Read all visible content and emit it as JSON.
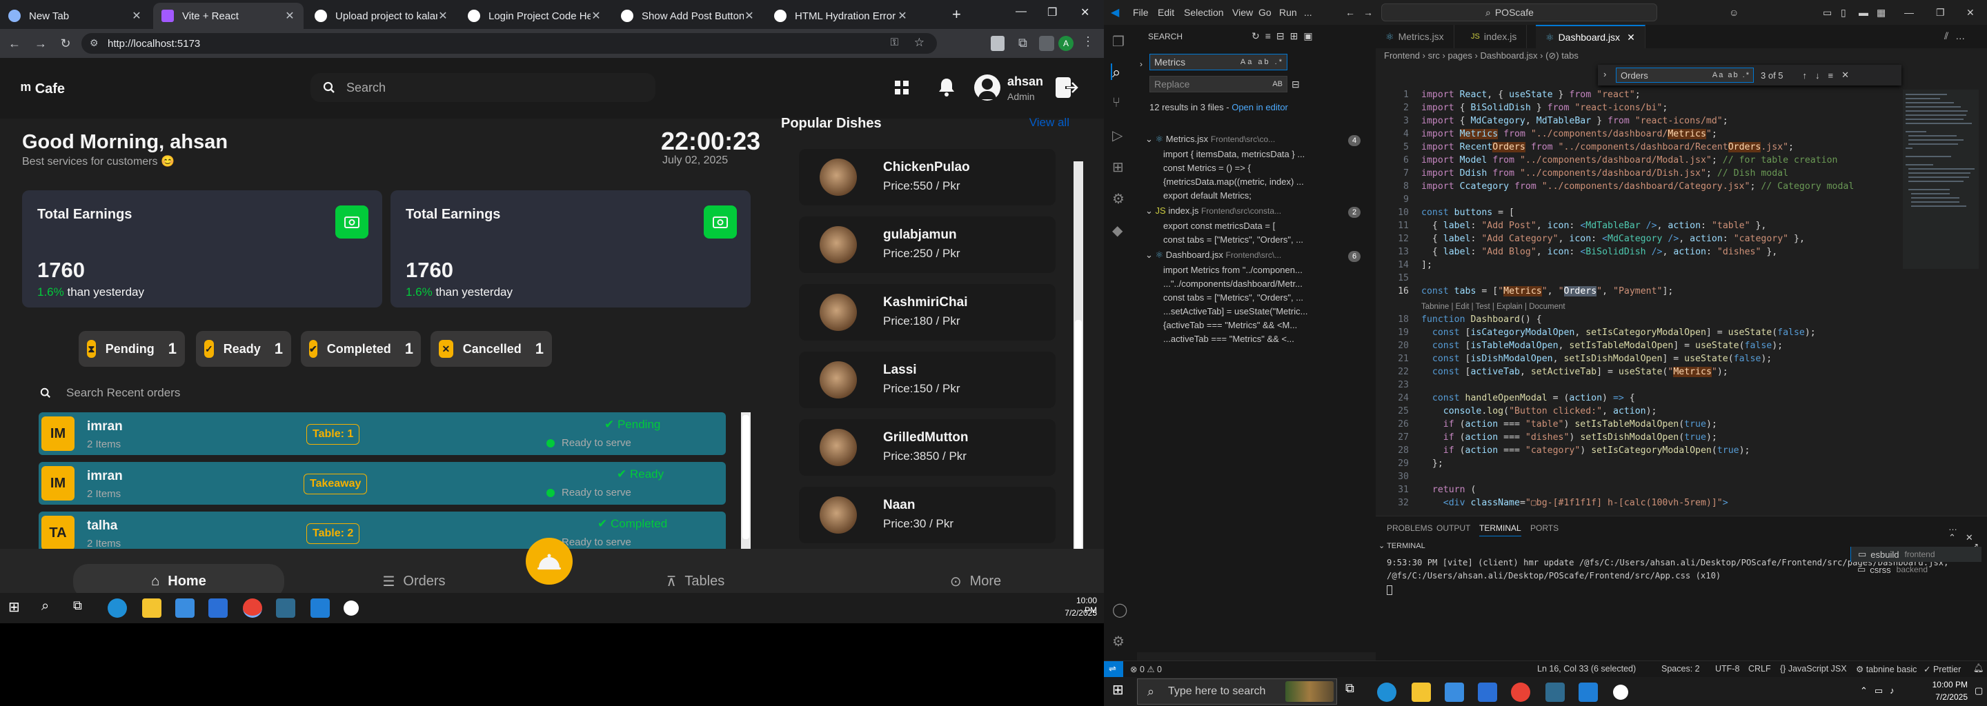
{
  "chrome": {
    "tabs": [
      {
        "title": "New Tab",
        "color": "#8ab4f8"
      },
      {
        "title": "Vite + React",
        "color": "#a259ff"
      },
      {
        "title": "Upload project to kalams.org",
        "color": "#ffffff"
      },
      {
        "title": "Login Project Code Help",
        "color": "#ffffff"
      },
      {
        "title": "Show Add Post Button",
        "color": "#ffffff"
      },
      {
        "title": "HTML Hydration Error Fix",
        "color": "#ffffff"
      }
    ],
    "url": "http://localhost:5173",
    "window_controls": {
      "min": "—",
      "max": "❐",
      "close": "✕"
    }
  },
  "app": {
    "logo": "Cafe",
    "search_placeholder": "Search",
    "user": {
      "name": "ahsan",
      "role": "Admin"
    },
    "greeting": "Good Morning, ahsan",
    "greeting_sub": "Best services for customers 😊",
    "time": "22:00:23",
    "date": "July 02, 2025",
    "earnings": [
      {
        "title": "Total Earnings",
        "value": "1760",
        "delta": "1.6%",
        "delta_text": "than yesterday"
      },
      {
        "title": "Total Earnings",
        "value": "1760",
        "delta": "1.6%",
        "delta_text": "than yesterday"
      }
    ],
    "stats": [
      {
        "label": "Pending",
        "count": "1"
      },
      {
        "label": "Ready",
        "count": "1"
      },
      {
        "label": "Completed",
        "count": "1"
      },
      {
        "label": "Cancelled",
        "count": "1"
      }
    ],
    "orders_search_placeholder": "Search Recent orders",
    "orders": [
      {
        "initials": "IM",
        "name": "imran",
        "items": "2 Items",
        "table": "Table: 1",
        "status": "Pending",
        "ready": "Ready to serve"
      },
      {
        "initials": "IM",
        "name": "imran",
        "items": "2 Items",
        "table": "Takeaway",
        "status": "Ready",
        "ready": "Ready to serve"
      },
      {
        "initials": "TA",
        "name": "talha",
        "items": "2 Items",
        "table": "Table: 2",
        "status": "Completed",
        "ready": "Ready to serve"
      }
    ],
    "dishes_title": "Popular Dishes",
    "view_all": "View all",
    "dishes": [
      {
        "name": "ChickenPulao",
        "price": "Price:550 / Pkr"
      },
      {
        "name": "gulabjamun",
        "price": "Price:250 / Pkr"
      },
      {
        "name": "KashmiriChai",
        "price": "Price:180 / Pkr"
      },
      {
        "name": "Lassi",
        "price": "Price:150 / Pkr"
      },
      {
        "name": "GrilledMutton",
        "price": "Price:3850 / Pkr"
      },
      {
        "name": "Naan",
        "price": "Price:30 / Pkr"
      }
    ],
    "nav": {
      "home": "Home",
      "orders": "Orders",
      "tables": "Tables",
      "more": "More"
    }
  },
  "taskbar_left": {
    "time": "10:00 PM",
    "date": "7/2/2025"
  },
  "vscode": {
    "menu": [
      "File",
      "Edit",
      "Selection",
      "View",
      "Go",
      "Run",
      "..."
    ],
    "command_center": "POScafe",
    "sidebar_title": "SEARCH",
    "search_value": "Metrics",
    "replace_placeholder": "Replace",
    "results_summary": "12 results in 3 files - ",
    "open_in_editor": "Open in editor",
    "files": [
      {
        "name": "Metrics.jsx",
        "path": "Frontend\\src\\co...",
        "count": "4",
        "matches": [
          "import { itemsData, metricsData } ...",
          "const Metrics = () => {",
          "{metricsData.map((metric, index) ...",
          "export default Metrics;"
        ]
      },
      {
        "name": "index.js",
        "path": "Frontend\\src\\consta...",
        "count": "2",
        "matches": [
          "export const metricsData = [",
          "const tabs = [\"Metrics\", \"Orders\", ..."
        ]
      },
      {
        "name": "Dashboard.jsx",
        "path": "Frontend\\src\\...",
        "count": "6",
        "matches": [
          "import Metrics from \"../componen...",
          "...\"../components/dashboard/Metr...",
          "const tabs = [\"Metrics\", \"Orders\", ...",
          "...setActiveTab] = useState(\"Metric...",
          "{activeTab === \"Metrics\" && <M...",
          "...activeTab === \"Metrics\" && <..."
        ]
      }
    ],
    "editor_tabs": [
      "Metrics.jsx",
      "index.js",
      "Dashboard.jsx"
    ],
    "breadcrumb": "Frontend › src › pages › Dashboard.jsx › (⊘) tabs",
    "find": {
      "value": "Orders",
      "count": "3 of 5"
    },
    "codelens": "Tabnine | Edit | Test | Explain | Document",
    "panel_tabs": [
      "PROBLEMS",
      "OUTPUT",
      "TERMINAL",
      "PORTS"
    ],
    "terminal_label": "TERMINAL",
    "terminal_lines": [
      "9:53:30 PM [vite] (client) hmr update /@fs/C:/Users/ahsan.ali/Desktop/POScafe/Frontend/src/pages/Dashboard.jsx,",
      "/@fs/C:/Users/ahsan.ali/Desktop/POScafe/Frontend/src/App.css (x10)"
    ],
    "terminal_sessions": [
      {
        "name": "esbuild",
        "tag": "frontend"
      },
      {
        "name": "csrss",
        "tag": "backend"
      }
    ],
    "status": {
      "errors": "⊗ 0 ⚠ 0",
      "position": "Ln 16, Col 33 (6 selected)",
      "spaces": "Spaces: 2",
      "encoding": "UTF-8",
      "eol": "CRLF",
      "lang": "{} JavaScript JSX",
      "tabnine": "tabnine basic",
      "prettier": "✓ Prettier"
    }
  },
  "taskbar_right": {
    "search": "Type here to search",
    "time": "10:00 PM",
    "date": "7/2/2025"
  }
}
